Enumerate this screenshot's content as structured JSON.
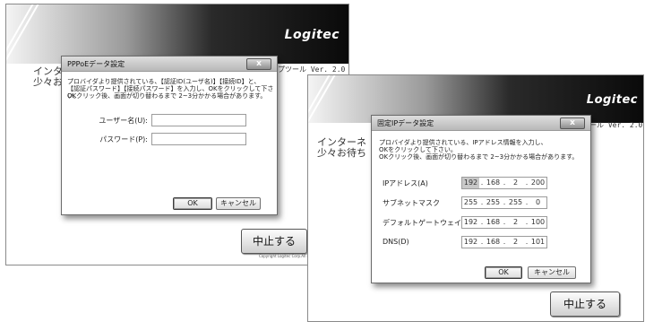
{
  "back_window": {
    "logo": "Logitec",
    "version": "ップツール  Ver. 2.0",
    "text_line1": "インター",
    "text_line2": "少々お待",
    "stop_button": "中止する",
    "copyright": "Copyright Logitec Corp.All r"
  },
  "pppoe_dialog": {
    "title": "PPPoEデータ設定",
    "close": "x",
    "description": [
      "プロバイダより提供されている、【認証ID(ユーザ名)】【接続ID】と、",
      "【認証パスワード】【接続パスワード】を入力し、OKをクリックして下さい。",
      "OKクリック後、画面が切り替わるまで 2~3分かかる場合があります。"
    ],
    "username_label": "ユーザー名(U):",
    "username_value": "",
    "password_label": "パスワード(P):",
    "password_value": "",
    "ok": "OK",
    "cancel": "キャンセル"
  },
  "front_window": {
    "logo": "Logitec",
    "version": "ップツール  Ver. 2.0",
    "text_line1": "インターネ",
    "text_line2": "少々お待ち",
    "stop_button": "中止する"
  },
  "static_ip_dialog": {
    "title": "固定IPデータ設定",
    "close": "x",
    "description": [
      "プロバイダより提供されている、IPアドレス情報を入力し、",
      "OKをクリックして下さい。",
      "OKクリック後、画面が切り替わるまで 2~3分かかる場合があります。"
    ],
    "fields": [
      {
        "label": "IPアドレス(A)",
        "octets": [
          "192",
          "168",
          "2",
          "200"
        ]
      },
      {
        "label": "サブネットマスク",
        "octets": [
          "255",
          "255",
          "255",
          "0"
        ]
      },
      {
        "label": "デフォルトゲートウェイ",
        "octets": [
          "192",
          "168",
          "2",
          "100"
        ]
      },
      {
        "label": "DNS(D)",
        "octets": [
          "192",
          "168",
          "2",
          "101"
        ]
      }
    ],
    "ok": "OK",
    "cancel": "キャンセル"
  }
}
